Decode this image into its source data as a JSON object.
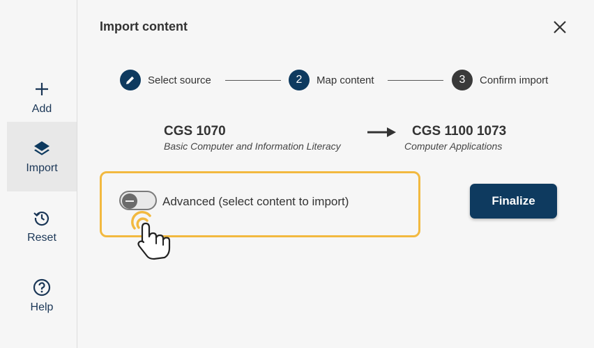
{
  "sidebar": {
    "items": [
      {
        "label": "Add",
        "icon": "plus-icon"
      },
      {
        "label": "Import",
        "icon": "layers-icon",
        "active": true
      },
      {
        "label": "Reset",
        "icon": "history-icon"
      },
      {
        "label": "Help",
        "icon": "help-circle-icon"
      }
    ]
  },
  "dialog": {
    "title": "Import content",
    "close_icon": "close-icon"
  },
  "stepper": {
    "steps": [
      {
        "number": "",
        "label": "Select source",
        "state": "completed",
        "icon": "pencil-icon"
      },
      {
        "number": "2",
        "label": "Map content",
        "state": "current"
      },
      {
        "number": "3",
        "label": "Confirm import",
        "state": "upcoming"
      }
    ]
  },
  "mapping": {
    "source": {
      "code": "CGS 1070",
      "name": "Basic Computer and Information Literacy"
    },
    "target": {
      "code": "CGS 1100 1073",
      "name": "Computer Applications"
    },
    "arrow_icon": "arrow-right-icon"
  },
  "advanced": {
    "label": "Advanced (select content to import)",
    "enabled": false
  },
  "actions": {
    "finalize_label": "Finalize"
  },
  "colors": {
    "brand": "#0e3a5f",
    "step_upcoming": "#3a3a3a",
    "highlight": "#f2b940",
    "background": "#f6f6f6"
  }
}
